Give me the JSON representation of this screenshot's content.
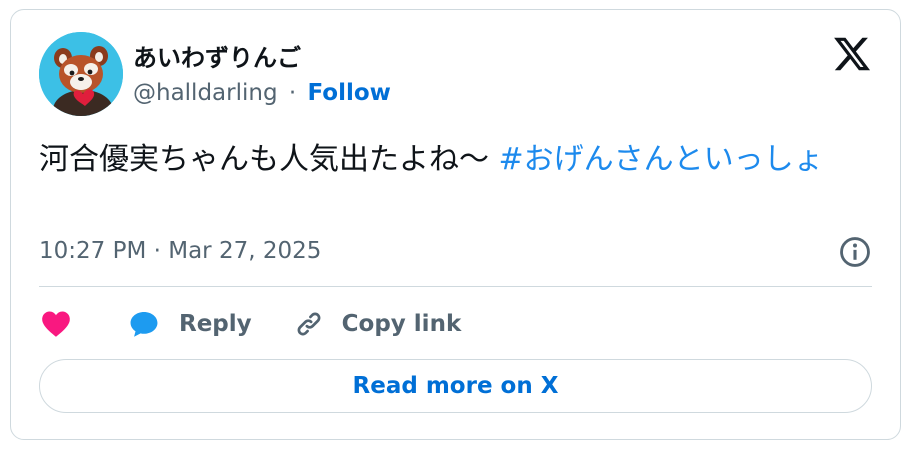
{
  "author": {
    "display_name": "あいわずりんご",
    "handle": "@halldarling",
    "separator": "·",
    "follow_label": "Follow"
  },
  "tweet": {
    "text": "河合優実ちゃんも人気出たよね〜 ",
    "hashtag": "#おげんさんといっしょ",
    "timestamp": "10:27 PM · Mar 27, 2025"
  },
  "actions": {
    "reply_label": "Reply",
    "copy_link_label": "Copy link"
  },
  "read_more_label": "Read more on X",
  "colors": {
    "link_blue": "#006fd6",
    "hashtag_blue": "#1d8aed",
    "heart_red": "#f91880",
    "reply_blue": "#1d9bf0",
    "muted_gray": "#536471",
    "border": "#cfd9de"
  }
}
